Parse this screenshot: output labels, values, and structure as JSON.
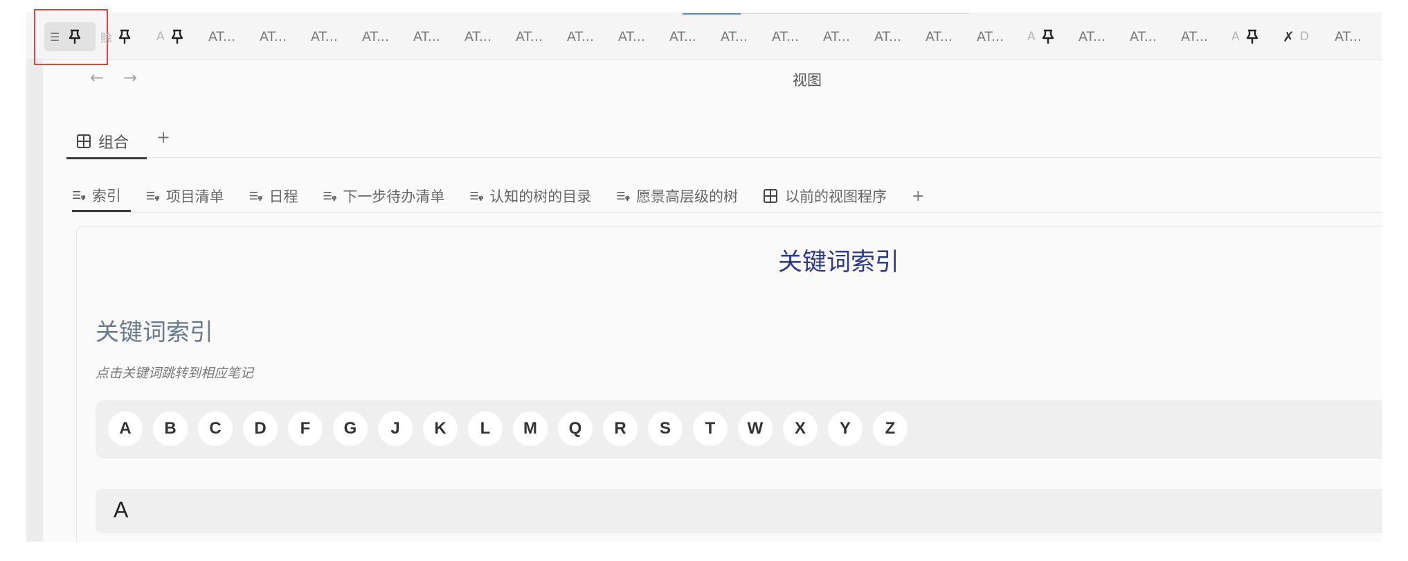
{
  "tab_strip": {
    "first_tab": {
      "menu_icon": "menu-lines-icon",
      "pin_icon": "pin-icon"
    },
    "tabs": [
      {
        "label": "赊",
        "pinned": true
      },
      {
        "label": "A",
        "pinned": true
      },
      {
        "label": "AT..."
      },
      {
        "label": "AT..."
      },
      {
        "label": "AT..."
      },
      {
        "label": "AT..."
      },
      {
        "label": "AT..."
      },
      {
        "label": "AT..."
      },
      {
        "label": "AT..."
      },
      {
        "label": "AT..."
      },
      {
        "label": "AT..."
      },
      {
        "label": "AT..."
      },
      {
        "label": "AT..."
      },
      {
        "label": "AT..."
      },
      {
        "label": "AT..."
      },
      {
        "label": "AT..."
      },
      {
        "label": "AT..."
      },
      {
        "label": "AT..."
      },
      {
        "label": "A",
        "pinned": true
      },
      {
        "label": "AT..."
      },
      {
        "label": "AT..."
      },
      {
        "label": "AT..."
      },
      {
        "label": "A",
        "pinned": true
      },
      {
        "label": "D",
        "icon": "tools-icon"
      },
      {
        "label": "AT..."
      }
    ]
  },
  "nav": {
    "back_icon": "arrow-left-icon",
    "forward_icon": "arrow-right-icon",
    "title": "视图"
  },
  "group_tabs": {
    "active_label": "组合",
    "add_label": "+"
  },
  "view_tabs": {
    "items": [
      {
        "label": "索引",
        "icon": "list-search-icon",
        "active": true
      },
      {
        "label": "项目清单",
        "icon": "list-search-icon"
      },
      {
        "label": "日程",
        "icon": "list-search-icon"
      },
      {
        "label": "下一步待办清单",
        "icon": "list-search-icon"
      },
      {
        "label": "认知的树的目录",
        "icon": "list-search-icon"
      },
      {
        "label": "愿景高层级的树",
        "icon": "list-search-icon"
      },
      {
        "label": "以前的视图程序",
        "icon": "grid-icon"
      }
    ],
    "add_label": "+"
  },
  "content": {
    "card_title": "关键词索引",
    "section_title": "关键词索引",
    "section_hint": "点击关键词跳转到相应笔记",
    "letters": [
      "A",
      "B",
      "C",
      "D",
      "F",
      "G",
      "J",
      "K",
      "L",
      "M",
      "Q",
      "R",
      "S",
      "T",
      "W",
      "X",
      "Y",
      "Z"
    ],
    "first_group_letter": "A"
  },
  "colors": {
    "title_blue": "#2d3a8c",
    "highlight_red": "#e04444",
    "accent_blue": "#4a8ad6"
  }
}
